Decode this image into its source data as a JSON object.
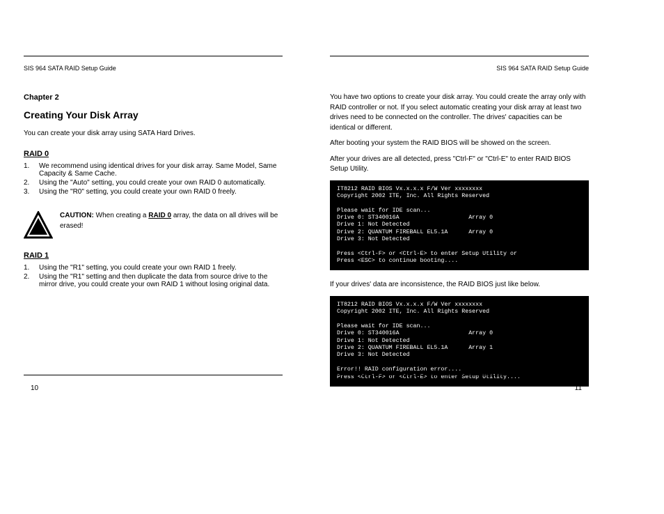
{
  "left": {
    "header_title": "SIS 964 SATA RAID Setup Guide",
    "section": "Chapter 2",
    "title": "Creating Your Disk Array",
    "intro": "You can create your disk array using SATA Hard Drives.",
    "raid0_title": "RAID 0",
    "raid0_steps": [
      "We recommend using identical drives for your disk array. Same Model, Same Capacity & Same Cache.",
      "Using the \"Auto\" setting, you could create your own RAID 0 automatically.",
      "Using the \"R0\" setting, you could create your own RAID 0 freely."
    ],
    "caution_title": "CAUTION:",
    "caution_text": "When creating a RAID 0 array, the data on all drives will be erased!",
    "raid1_title": "RAID 1",
    "raid1_steps": [
      "Using the \"R1\" setting, you could create your own RAID 1 freely.",
      "Using the \"R1\" setting and then duplicate the data from source drive to the mirror drive, you could create your own RAID 1 without losing original data."
    ],
    "page_num": "10"
  },
  "right": {
    "header_title": "SIS 964 SATA RAID Setup Guide",
    "para1": "You have two options to create your disk array. You could create the array only with RAID controller or not. If you select automatic creating your disk array at least two drives need to be connected on the controller. The drives' capacities can be identical or different.",
    "para2": "After booting your system the RAID BIOS will be showed on the screen.",
    "para3": "After your drives are all detected, press \"Ctrl-F\" or \"Ctrl-E\" to enter RAID BIOS Setup Utility.",
    "bios1_l1": "IT8212 RAID BIOS Vx.x.x.x F/W Ver xxxxxxxx",
    "bios1_l2": "Copyright 2002 ITE, Inc. All Rights Reserved",
    "bios1_l3": "Please wait for IDE scan...",
    "bios1_l4": "Drive 0: ST340016A                    Array 0",
    "bios1_l5": "Drive 1: Not Detected",
    "bios1_l6": "Drive 2: QUANTUM FIREBALL EL5.1A      Array 0",
    "bios1_l7": "Drive 3: Not Detected",
    "bios1_l8": "Press <Ctrl-F> or <Ctrl-E> to enter Setup Utility or",
    "bios1_l9": "Press <ESC> to continue booting....",
    "para4": "If your drives' data are inconsistence, the RAID BIOS just like below.",
    "bios2_l1": "IT8212 RAID BIOS Vx.x.x.x F/W Ver xxxxxxxx",
    "bios2_l2": "Copyright 2002 ITE, Inc. All Rights Reserved",
    "bios2_l3": "Please wait for IDE scan...",
    "bios2_l4": "Drive 0: ST340016A                    Array 0",
    "bios2_l5": "Drive 1: Not Detected",
    "bios2_l6": "Drive 2: QUANTUM FIREBALL EL5.1A      Array 1",
    "bios2_l7": "Drive 3: Not Detected",
    "bios2_l8": "Error!! RAID configuration error....",
    "bios2_l9": "Press <Ctrl-F> or <Ctrl-E> to enter Setup Utility....",
    "page_num": "11"
  }
}
